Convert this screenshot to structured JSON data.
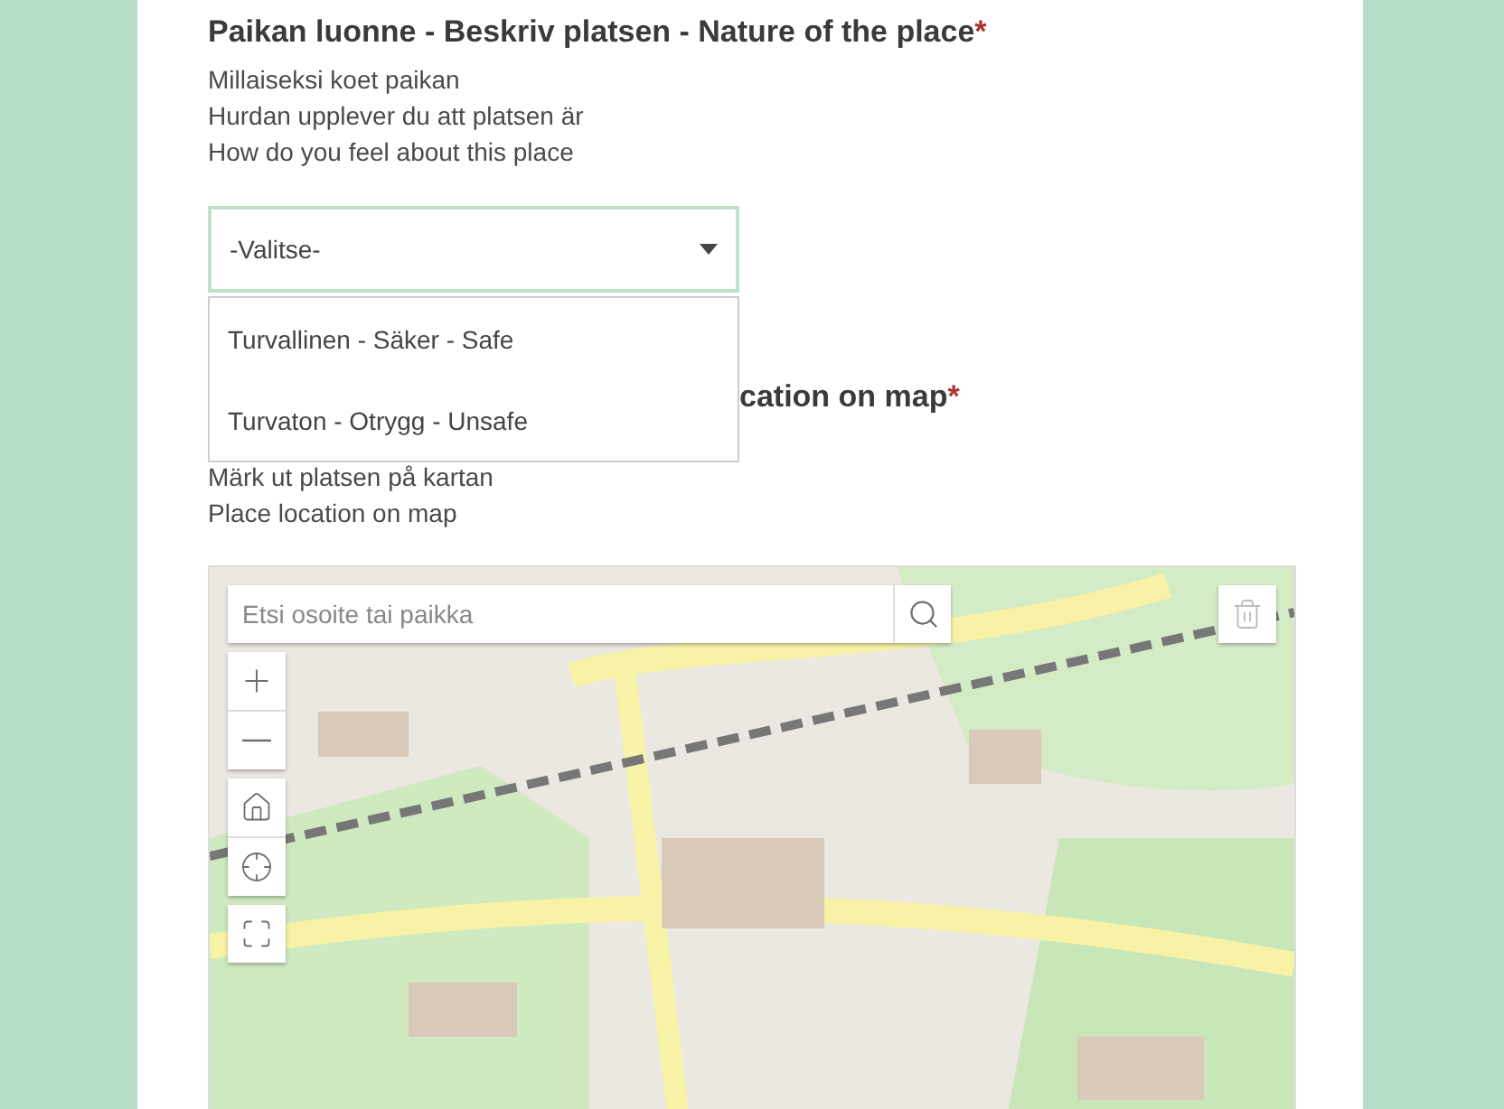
{
  "question": {
    "title": "Paikan luonne - Beskriv platsen - Nature of the place",
    "required_mark": "*",
    "description": [
      "Millaiseksi koet paikan",
      "Hurdan upplever du att platsen är",
      "How do you feel about this place"
    ]
  },
  "dropdown": {
    "value": "-Valitse-",
    "expanded": true,
    "options": [
      {
        "label": "Turvallinen - Säker - Safe",
        "selected": false
      },
      {
        "label": "Turvaton - Otrygg - Unsafe",
        "selected": false
      }
    ]
  },
  "location_question": {
    "title": "cation on map",
    "required_mark": "*",
    "description": [
      "Märk ut platsen på kartan",
      "Place location on map"
    ]
  },
  "map": {
    "kind": "picture",
    "search": {
      "placeholder": "Etsi osoite tai paikka"
    }
  }
}
